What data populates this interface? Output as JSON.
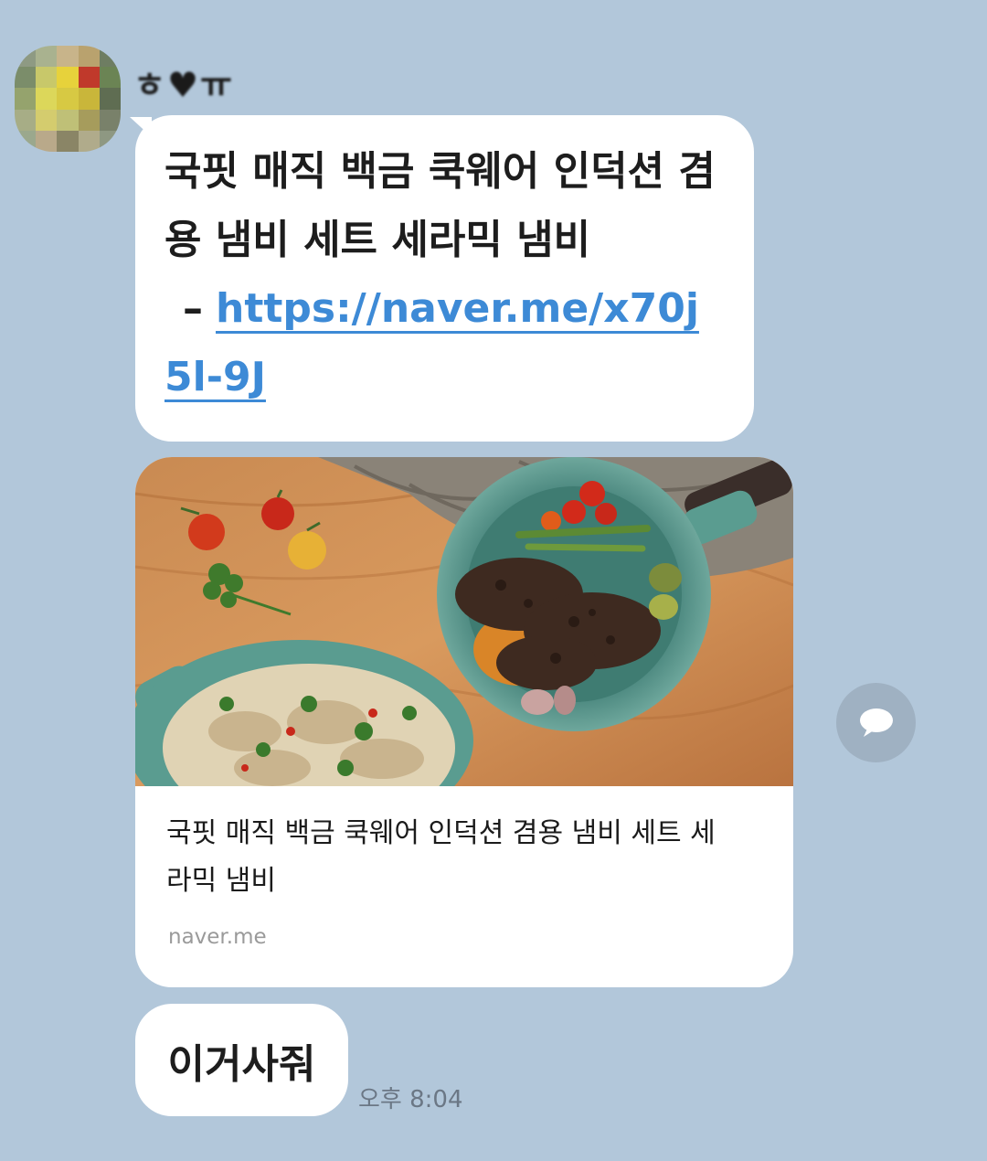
{
  "sender": {
    "name": "ㅎ♥ㅠ"
  },
  "messages": {
    "link_message": {
      "text": "국핏 매직 백금 쿡웨어 인덕션 겸용 냄비 세트 세라믹 냄비",
      "separator": "–",
      "url": "https://naver.me/x70j5l-9J"
    },
    "preview_card": {
      "title": "국핏 매직 백금 쿡웨어 인덕션 겸용 냄비 세트 세라믹 냄비",
      "domain": "naver.me",
      "image_icon": "cookware-photo"
    },
    "short_message": {
      "text": "이거사줘"
    },
    "timestamp": "오후 8:04"
  },
  "actions": {
    "share_icon": "chat-bubble-icon"
  },
  "colors": {
    "background": "#b2c7da",
    "bubble": "#ffffff",
    "link": "#3d8ad6",
    "share_button": "#9fb1c2"
  }
}
